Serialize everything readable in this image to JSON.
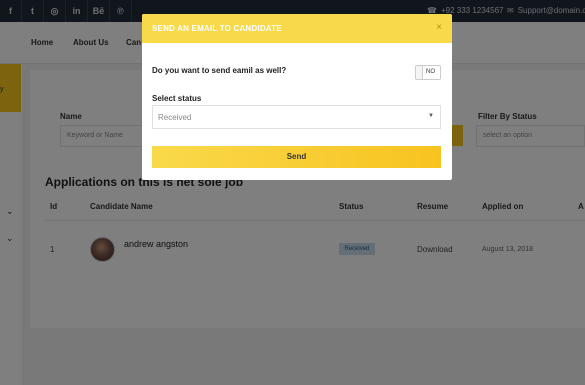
{
  "topbar": {
    "social": [
      {
        "name": "facebook-icon",
        "glyph": "f"
      },
      {
        "name": "twitter-icon",
        "glyph": "t"
      },
      {
        "name": "instagram-icon",
        "glyph": "◎"
      },
      {
        "name": "linkedin-icon",
        "glyph": "in"
      },
      {
        "name": "behance-icon",
        "glyph": "Bē"
      },
      {
        "name": "pinterest-icon",
        "glyph": "℗"
      }
    ],
    "phone": "+92 333 1234567",
    "email": "Support@domain.com"
  },
  "nav": {
    "home": "Home",
    "about": "About Us",
    "partial": "Can"
  },
  "sidebar": {
    "active_label": "y"
  },
  "filters": {
    "name_label": "Name",
    "name_placeholder": "Keyword or Name",
    "filter_status_label": "Filter By Status",
    "filter_status_placeholder": "select an option"
  },
  "applications": {
    "title": "Applications on this is net sole job",
    "headers": {
      "id": "Id",
      "candidate": "Candidate Name",
      "status": "Status",
      "resume": "Resume",
      "applied": "Applied on",
      "extra": "A"
    },
    "rows": [
      {
        "id": "1",
        "candidate": "andrew angston",
        "status": "Received",
        "resume": "Download",
        "applied": "August 13, 2018"
      }
    ]
  },
  "modal": {
    "title": "SEND AN EMAIL TO CANDIDATE",
    "close": "×",
    "question": "Do you want to send eamil as well?",
    "toggle_label": "NO",
    "status_label": "Select status",
    "status_value": "Received",
    "send_label": "Send"
  },
  "colors": {
    "accent": "#f8c61b",
    "topbar": "#232c3a"
  }
}
